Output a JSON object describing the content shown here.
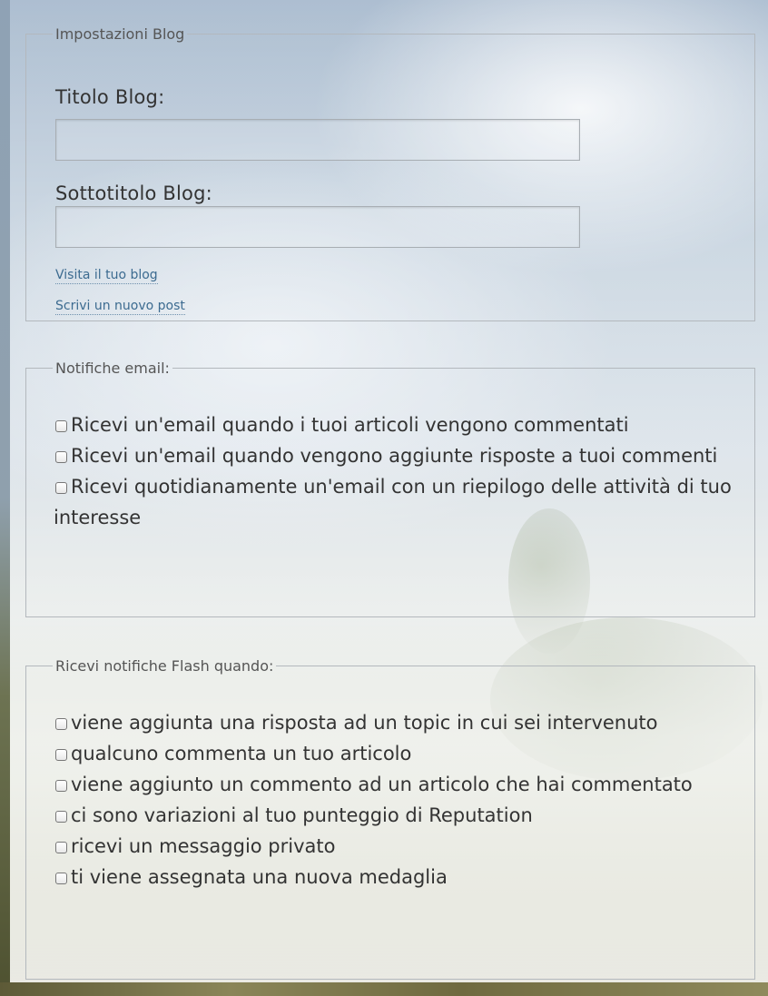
{
  "blog_settings": {
    "legend": "Impostazioni Blog",
    "title_label": "Titolo Blog:",
    "title_value": "",
    "subtitle_label": "Sottotitolo Blog:",
    "subtitle_value": "",
    "visit_link": "Visita il tuo blog",
    "new_post_link": "Scrivi un nuovo post"
  },
  "email_notifications": {
    "legend": "Notifiche email:",
    "options": [
      "Ricevi un'email quando i tuoi articoli vengono commentati",
      "Ricevi un'email quando vengono aggiunte risposte a tuoi commenti",
      "Ricevi quotidianamente un'email con un riepilogo delle attività di tuo interesse"
    ]
  },
  "flash_notifications": {
    "legend": "Ricevi notifiche Flash quando:",
    "options": [
      "viene aggiunta una risposta ad un topic in cui sei intervenuto",
      "qualcuno commenta un tuo articolo",
      "viene aggiunto un commento ad un articolo che hai commentato",
      "ci sono variazioni al tuo punteggio di Reputation",
      "ricevi un messaggio privato",
      "ti viene assegnata una nuova medaglia"
    ]
  },
  "colors": {
    "link": "#3c6b90",
    "text": "#333333",
    "border": "#b3b8bd"
  },
  "icons": {
    "checkbox": "checkbox-icon"
  }
}
